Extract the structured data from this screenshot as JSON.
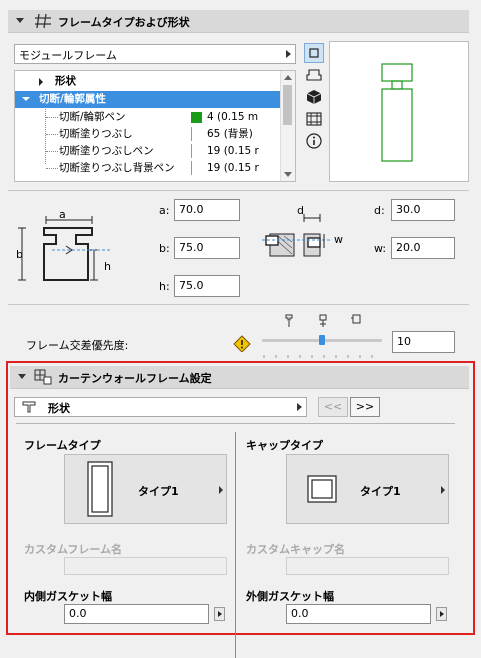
{
  "section1": {
    "title": "フレームタイプおよび形状",
    "dropdown_value": "モジュールフレーム"
  },
  "tree": {
    "items": [
      {
        "label": "形状"
      },
      {
        "label": "切断/輪郭属性"
      },
      {
        "label": "切断/輪郭ペン",
        "value": "4 (0.15 m"
      },
      {
        "label": "切断塗りつぶし",
        "value": "65 (背景)"
      },
      {
        "label": "切断塗りつぶしペン",
        "value": "19 (0.15 r"
      },
      {
        "label": "切断塗りつぶし背景ペン",
        "value": "19 (0.15 r"
      }
    ],
    "swatch_color": "#1a9b1a"
  },
  "dims": {
    "a_label": "a:",
    "a_value": "70.0",
    "b_label": "b:",
    "b_value": "75.0",
    "h_label": "h:",
    "h_value": "75.0",
    "d_label": "d:",
    "d_value": "30.0",
    "w_label": "w:",
    "w_value": "20.0",
    "diag_a": "a",
    "diag_b": "b",
    "diag_h": "h",
    "diag_d": "d",
    "diag_w": "w"
  },
  "priority": {
    "label": "フレーム交差優先度:",
    "value": "10",
    "slider_fraction": 0.5
  },
  "section2": {
    "title": "カーテンウォールフレーム設定",
    "page_label": "形状",
    "prev_label": "<<",
    "next_label": ">>"
  },
  "frame": {
    "type_heading": "フレームタイプ",
    "type_value": "タイプ1",
    "custom_label": "カスタムフレーム名",
    "gasket_label": "内側ガスケット幅",
    "gasket_value": "0.0"
  },
  "cap": {
    "type_heading": "キャップタイプ",
    "type_value": "タイプ1",
    "custom_label": "カスタムキャップ名",
    "gasket_label": "外側ガスケット幅",
    "gasket_value": "0.0"
  },
  "colors": {
    "accent": "#3c8fde",
    "highlight_border": "#e02020",
    "preview_stroke": "#1a9b1a"
  }
}
